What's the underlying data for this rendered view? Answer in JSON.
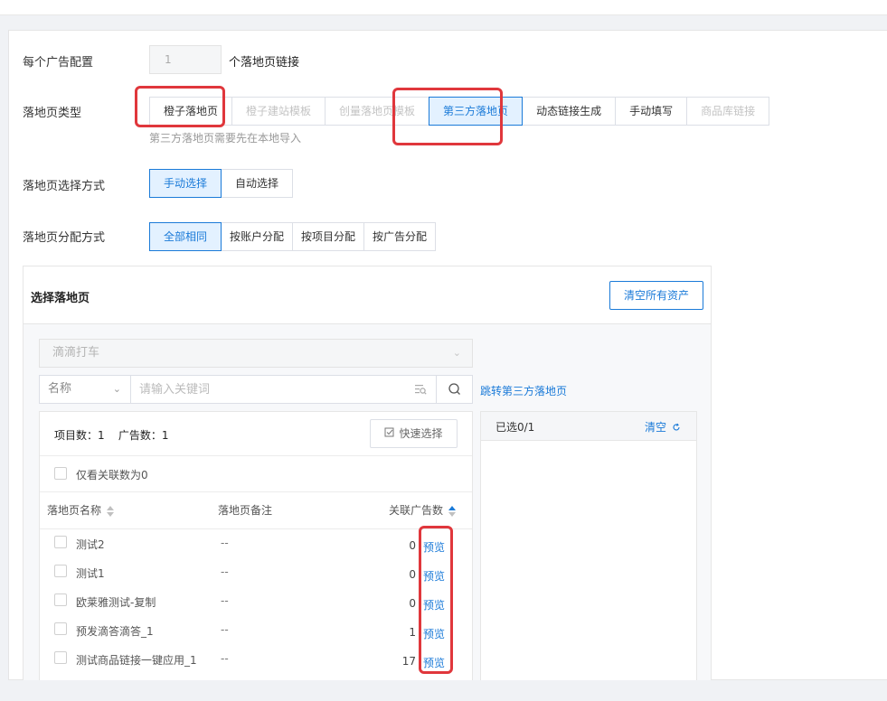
{
  "config": {
    "ad_config_label": "每个广告配置",
    "link_count_value": "1",
    "link_count_suffix": "个落地页链接"
  },
  "landing_type": {
    "label": "落地页类型",
    "options": [
      "橙子落地页",
      "橙子建站模板",
      "创量落地页模板",
      "第三方落地页",
      "动态链接生成",
      "手动填写",
      "商品库链接"
    ],
    "selected": "第三方落地页",
    "hint": "第三方落地页需要先在本地导入"
  },
  "select_method": {
    "label": "落地页选择方式",
    "options": [
      "手动选择",
      "自动选择"
    ],
    "selected": "手动选择"
  },
  "distribution": {
    "label": "落地页分配方式",
    "options": [
      "全部相同",
      "按账户分配",
      "按项目分配",
      "按广告分配"
    ],
    "selected": "全部相同"
  },
  "picker": {
    "title": "选择落地页",
    "clear_all_label": "清空所有资产",
    "account_value": "滴滴打车",
    "search_type": "名称",
    "search_placeholder": "请输入关键词",
    "jump_link": "跳转第三方落地页",
    "stats": "项目数：1    广告数：1",
    "quick_select_label": "快速选择",
    "only_zero_label": "仅看关联数为0",
    "columns": {
      "name": "落地页名称",
      "note": "落地页备注",
      "count": "关联广告数"
    },
    "rows": [
      {
        "name": "测试2",
        "note": "--",
        "count": "0",
        "action": "预览"
      },
      {
        "name": "测试1",
        "note": "--",
        "count": "0",
        "action": "预览"
      },
      {
        "name": "欧莱雅测试-复制",
        "note": "--",
        "count": "0",
        "action": "预览"
      },
      {
        "name": "预发滴答滴答_1",
        "note": "--",
        "count": "1",
        "action": "预览"
      },
      {
        "name": "测试商品链接一键应用_1",
        "note": "--",
        "count": "17",
        "action": "预览"
      }
    ],
    "selected_count": "已选0/1",
    "clear_selected": "清空"
  },
  "colors": {
    "accent": "#1a7ad8",
    "active_bg": "#e3f1ff",
    "highlight": "#e0373c"
  }
}
